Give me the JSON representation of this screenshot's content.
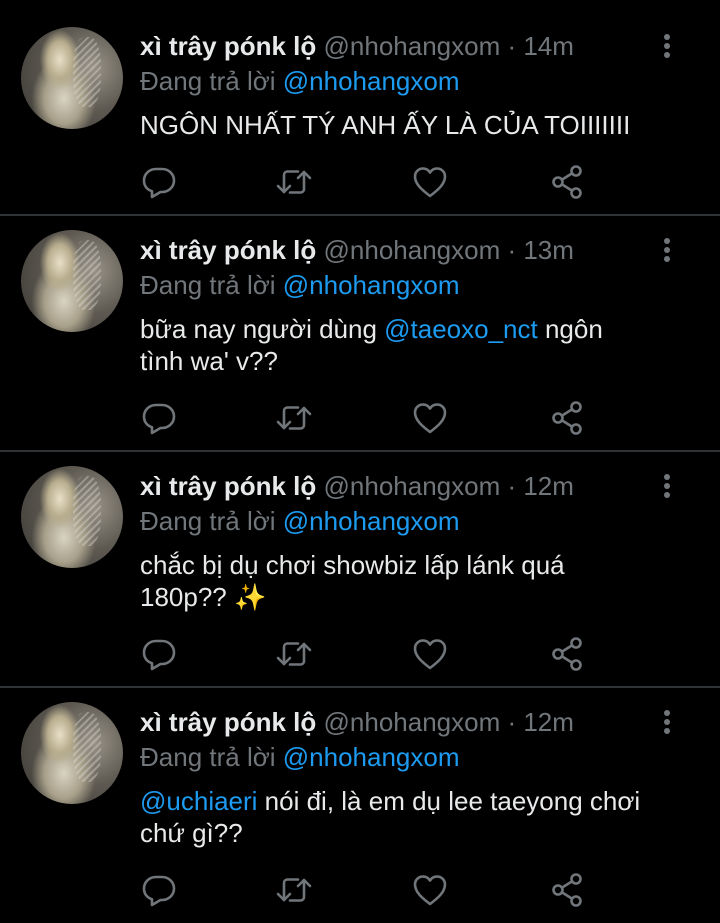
{
  "tweets": [
    {
      "name": "xì trây pónk lộ",
      "handle": "@nhohangxom",
      "time": "· 14m",
      "reply_prefix": "Đang trả lời ",
      "reply_to": "@nhohangxom",
      "lines": [
        [
          {
            "text": "NGÔN NHẤT TÝ ANH ẤY LÀ CỦA TOIIIIIII",
            "mention": false
          }
        ]
      ]
    },
    {
      "name": "xì trây pónk lộ",
      "handle": "@nhohangxom",
      "time": "· 13m",
      "reply_prefix": "Đang trả lời ",
      "reply_to": "@nhohangxom",
      "lines": [
        [
          {
            "text": "bữa nay người dùng ",
            "mention": false
          },
          {
            "text": "@taeoxo_nct",
            "mention": true
          },
          {
            "text": " ngôn",
            "mention": false
          }
        ],
        [
          {
            "text": "tình wa' v??",
            "mention": false
          }
        ]
      ]
    },
    {
      "name": "xì trây pónk lộ",
      "handle": "@nhohangxom",
      "time": "· 12m",
      "reply_prefix": "Đang trả lời ",
      "reply_to": "@nhohangxom",
      "lines": [
        [
          {
            "text": "chắc bị dụ chơi showbiz lấp lánk quá",
            "mention": false
          }
        ],
        [
          {
            "text": "180p?? ✨",
            "mention": false
          }
        ]
      ]
    },
    {
      "name": "xì trây pónk lộ",
      "handle": "@nhohangxom",
      "time": "· 12m",
      "reply_prefix": "Đang trả lời ",
      "reply_to": "@nhohangxom",
      "lines": [
        [
          {
            "text": "@uchiaeri",
            "mention": true
          },
          {
            "text": " nói đi, là em dụ lee taeyong chơi",
            "mention": false
          }
        ],
        [
          {
            "text": "chứ gì??",
            "mention": false
          }
        ]
      ]
    }
  ],
  "icons": {
    "more": "more-vertical-icon",
    "reply": "reply-icon",
    "retweet": "retweet-icon",
    "like": "heart-icon",
    "share": "share-icon"
  },
  "colors": {
    "background": "#000000",
    "text": "#e7e9ea",
    "muted": "#71767b",
    "link": "#1d9bf0",
    "divider": "#2f3336"
  }
}
